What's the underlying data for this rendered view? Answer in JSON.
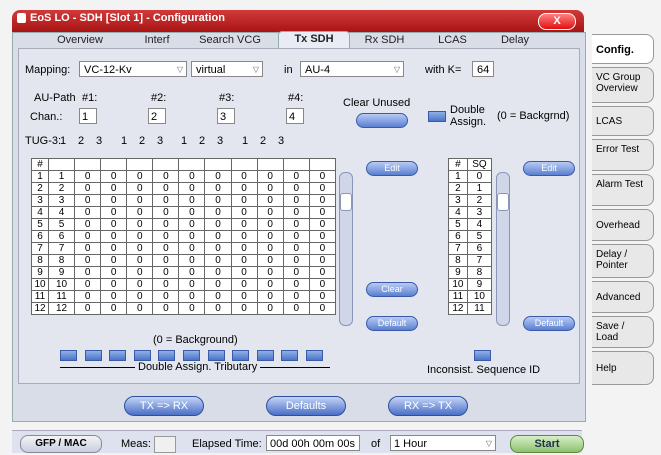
{
  "window": {
    "title": "EoS LO - SDH [Slot 1]  -  Configuration",
    "close_label": "X"
  },
  "tabs": [
    "Overview",
    "Interf",
    "Search VCG",
    "Tx SDH",
    "Rx SDH",
    "LCAS",
    "Delay"
  ],
  "active_tab": "Tx SDH",
  "mapping": {
    "label": "Mapping:",
    "value": "VC-12-Kv",
    "mode": "virtual",
    "in_label": "in",
    "in_value": "AU-4",
    "k_label": "with  K=",
    "k_value": "64"
  },
  "aupath": {
    "label": "AU-Path",
    "headers": [
      "#1:",
      "#2:",
      "#3:",
      "#4:"
    ],
    "chan_label": "Chan.:",
    "values": [
      "1",
      "2",
      "3",
      "4"
    ]
  },
  "clear_unused": "Clear Unused",
  "double_assign": {
    "label1": "Double",
    "label2": "Assign.",
    "note": "(0 = Backgrnd)"
  },
  "tug3": {
    "label": "TUG-3:",
    "groups": [
      {
        "num": "1",
        "vals": [
          "2",
          "3"
        ]
      },
      {
        "num": "1",
        "vals": [
          "2",
          "3"
        ]
      },
      {
        "num": "1",
        "vals": [
          "2",
          "3"
        ]
      },
      {
        "num": "1",
        "vals": [
          "2",
          "3"
        ]
      }
    ]
  },
  "left_table": {
    "header": "#",
    "rows": [
      [
        "1",
        "1",
        "0",
        "0",
        "0",
        "0",
        "0",
        "0",
        "0",
        "0",
        "0",
        "0"
      ],
      [
        "2",
        "2",
        "0",
        "0",
        "0",
        "0",
        "0",
        "0",
        "0",
        "0",
        "0",
        "0"
      ],
      [
        "3",
        "3",
        "0",
        "0",
        "0",
        "0",
        "0",
        "0",
        "0",
        "0",
        "0",
        "0"
      ],
      [
        "4",
        "4",
        "0",
        "0",
        "0",
        "0",
        "0",
        "0",
        "0",
        "0",
        "0",
        "0"
      ],
      [
        "5",
        "5",
        "0",
        "0",
        "0",
        "0",
        "0",
        "0",
        "0",
        "0",
        "0",
        "0"
      ],
      [
        "6",
        "6",
        "0",
        "0",
        "0",
        "0",
        "0",
        "0",
        "0",
        "0",
        "0",
        "0"
      ],
      [
        "7",
        "7",
        "0",
        "0",
        "0",
        "0",
        "0",
        "0",
        "0",
        "0",
        "0",
        "0"
      ],
      [
        "8",
        "8",
        "0",
        "0",
        "0",
        "0",
        "0",
        "0",
        "0",
        "0",
        "0",
        "0"
      ],
      [
        "9",
        "9",
        "0",
        "0",
        "0",
        "0",
        "0",
        "0",
        "0",
        "0",
        "0",
        "0"
      ],
      [
        "10",
        "10",
        "0",
        "0",
        "0",
        "0",
        "0",
        "0",
        "0",
        "0",
        "0",
        "0"
      ],
      [
        "11",
        "11",
        "0",
        "0",
        "0",
        "0",
        "0",
        "0",
        "0",
        "0",
        "0",
        "0"
      ],
      [
        "12",
        "12",
        "0",
        "0",
        "0",
        "0",
        "0",
        "0",
        "0",
        "0",
        "0",
        "0"
      ]
    ],
    "background_note": "(0 = Background)"
  },
  "left_buttons": {
    "edit": "Edit",
    "clear": "Clear",
    "default": "Default"
  },
  "right_table": {
    "headers": [
      "#",
      "SQ"
    ],
    "rows": [
      [
        "1",
        "0"
      ],
      [
        "2",
        "1"
      ],
      [
        "3",
        "2"
      ],
      [
        "4",
        "3"
      ],
      [
        "5",
        "4"
      ],
      [
        "6",
        "5"
      ],
      [
        "7",
        "6"
      ],
      [
        "8",
        "7"
      ],
      [
        "9",
        "8"
      ],
      [
        "10",
        "9"
      ],
      [
        "11",
        "10"
      ],
      [
        "12",
        "11"
      ]
    ]
  },
  "right_buttons": {
    "edit": "Edit",
    "default": "Default"
  },
  "double_assign_tributary": "Double Assign. Tributary",
  "inconsist_seq": "Inconsist. Sequence ID",
  "bottom_buttons": {
    "tx_rx": "TX => RX",
    "defaults": "Defaults",
    "rx_tx": "RX => TX"
  },
  "side_tabs": [
    "Config.",
    "VC Group Overview",
    "LCAS",
    "Error Test",
    "Alarm Test",
    "Overhead",
    "Delay / Pointer",
    "Advanced",
    "Save / Load",
    "Help"
  ],
  "statusbar": {
    "gfp_mac": "GFP / MAC",
    "meas_label": "Meas:",
    "elapsed_label": "Elapsed Time:",
    "elapsed_value": "00d 00h 00m 00s",
    "of_label": "of",
    "duration": "1 Hour",
    "start": "Start"
  }
}
